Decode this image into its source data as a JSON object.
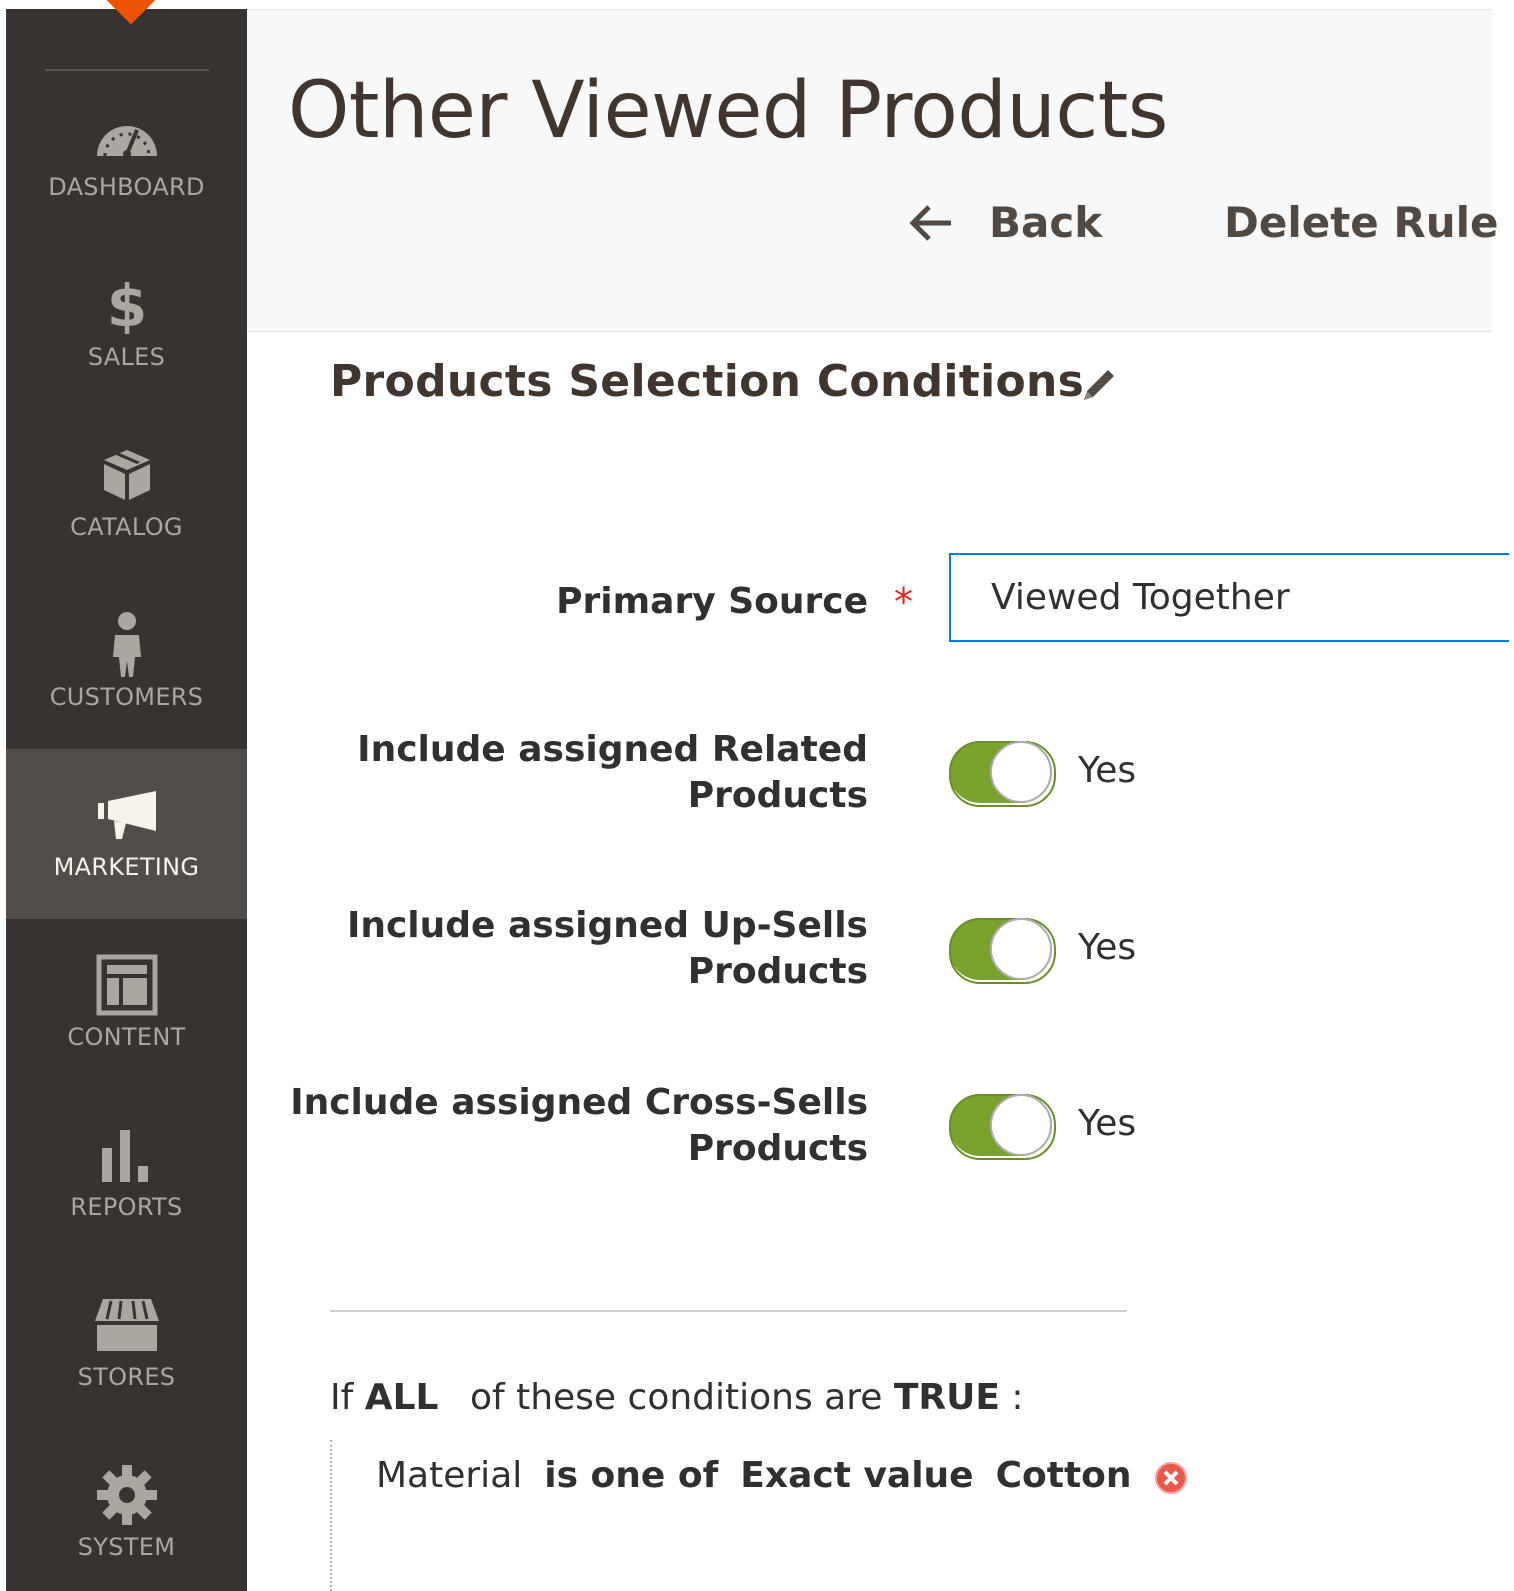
{
  "sidebar": {
    "items": [
      {
        "label": "DASHBOARD",
        "icon": "dashboard-gauge-icon"
      },
      {
        "label": "SALES",
        "icon": "dollar-icon"
      },
      {
        "label": "CATALOG",
        "icon": "box-icon"
      },
      {
        "label": "CUSTOMERS",
        "icon": "person-icon"
      },
      {
        "label": "MARKETING",
        "icon": "megaphone-icon",
        "active": true
      },
      {
        "label": "CONTENT",
        "icon": "layout-icon"
      },
      {
        "label": "REPORTS",
        "icon": "bar-chart-icon"
      },
      {
        "label": "STORES",
        "icon": "storefront-icon"
      },
      {
        "label": "SYSTEM",
        "icon": "gear-icon"
      }
    ]
  },
  "header": {
    "title": "Other Viewed Products",
    "back_label": "Back",
    "delete_label": "Delete Rule"
  },
  "section": {
    "title": "Products Selection Conditions",
    "primary_source": {
      "label": "Primary Source",
      "required_mark": "*",
      "value": "Viewed Together"
    },
    "toggles": [
      {
        "label_line1": "Include assigned Related",
        "label_line2": "Products",
        "value": "Yes",
        "on": true
      },
      {
        "label_line1": "Include assigned Up-Sells",
        "label_line2": "Products",
        "value": "Yes",
        "on": true
      },
      {
        "label_line1": "Include assigned Cross-Sells",
        "label_line2": "Products",
        "value": "Yes",
        "on": true
      }
    ]
  },
  "conditions": {
    "prefix": "If",
    "aggregator": "ALL",
    "middle": "of these conditions are",
    "value": "TRUE",
    "suffix": ":",
    "rows": [
      {
        "attribute": "Material",
        "operator": "is one of",
        "value_type": "Exact value",
        "value": "Cotton"
      }
    ]
  },
  "colors": {
    "sidebar_bg": "#373330",
    "sidebar_active_bg": "#524d49",
    "accent_orange": "#eb5202",
    "toggle_on": "#79a22e",
    "focus_border": "#007bdb",
    "required": "#e22626",
    "remove_icon": "#e85b4a"
  }
}
